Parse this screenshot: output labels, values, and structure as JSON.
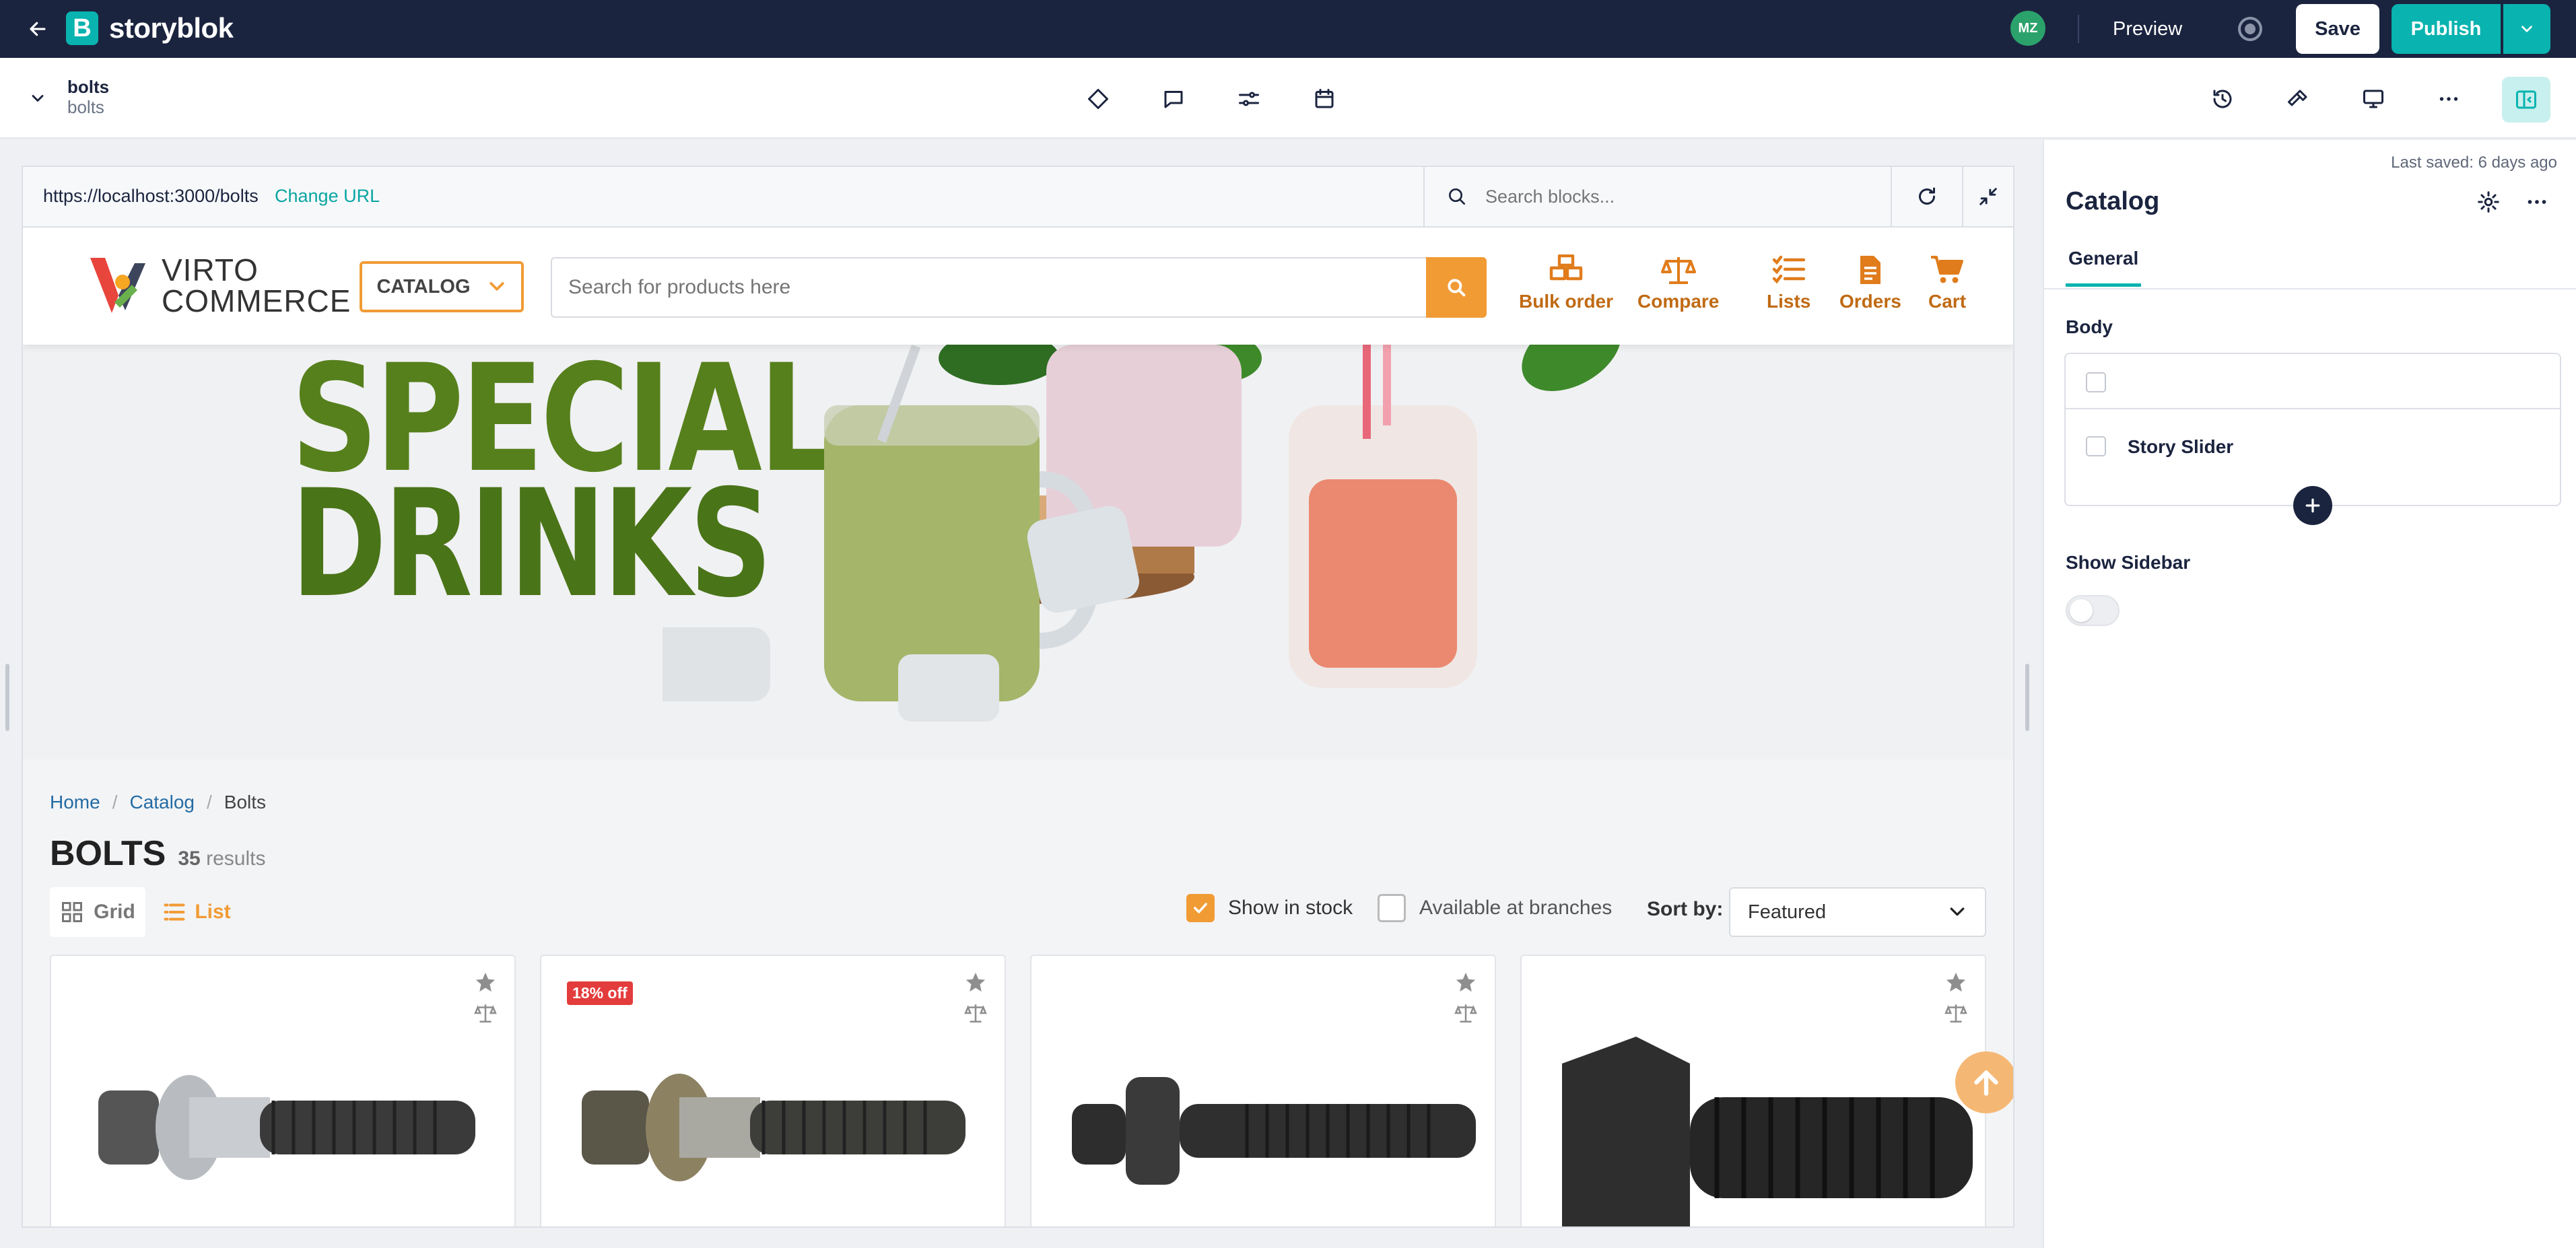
{
  "topbar": {
    "brand": "storyblok",
    "brand_mark": "B",
    "avatar_initials": "MZ",
    "preview_label": "Preview",
    "save_label": "Save",
    "publish_label": "Publish"
  },
  "story": {
    "title": "bolts",
    "slug": "bolts"
  },
  "preview": {
    "url": "https://localhost:3000/bolts",
    "change_url_label": "Change URL",
    "block_search_placeholder": "Search blocks..."
  },
  "site": {
    "logo_line1": "VIRTO",
    "logo_line2": "COMMERCE",
    "catalog_label": "CATALOG",
    "search_placeholder": "Search for products here",
    "header_links": [
      {
        "label": "Bulk order",
        "icon": "boxes-icon"
      },
      {
        "label": "Compare",
        "icon": "scale-icon"
      },
      {
        "label": "Lists",
        "icon": "checklist-icon"
      },
      {
        "label": "Orders",
        "icon": "document-icon"
      },
      {
        "label": "Cart",
        "icon": "cart-icon"
      }
    ],
    "banner": {
      "line1": "SPECIAL",
      "line2": "DRINKS"
    },
    "breadcrumb": [
      "Home",
      "Catalog",
      "Bolts"
    ],
    "heading": "BOLTS",
    "results_count": "35",
    "results_label": "results",
    "view_grid": "Grid",
    "view_list": "List",
    "show_in_stock": "Show in stock",
    "show_in_stock_checked": true,
    "available_at_branches": "Available at branches",
    "available_at_branches_checked": false,
    "sort_label": "Sort by:",
    "sort_value": "Featured",
    "products": [
      {
        "discount": ""
      },
      {
        "discount": "18% off"
      },
      {
        "discount": ""
      },
      {
        "discount": ""
      }
    ]
  },
  "panel": {
    "last_saved": "Last saved: 6 days ago",
    "title": "Catalog",
    "tab": "General",
    "body_label": "Body",
    "body_items": [
      "Story Slider"
    ],
    "show_sidebar_label": "Show Sidebar",
    "show_sidebar_on": false
  },
  "colors": {
    "topbar_bg": "#1b243f",
    "brand_teal": "#09b3af",
    "site_accent": "#f19b35",
    "discount_red": "#e33c3c"
  }
}
